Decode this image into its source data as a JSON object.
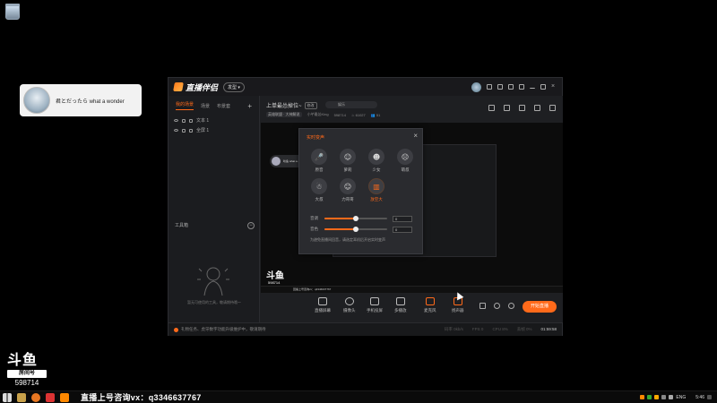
{
  "desktop": {
    "notification": {
      "text": "君とだったら what a wonder"
    },
    "watermark": {
      "brand": "斗鱼",
      "room_label": "房间号",
      "room_number": "598714"
    }
  },
  "taskbar": {
    "promo_text": "直播上号咨询vx：q3346637767",
    "tray": {
      "lang": "ENG",
      "time": "5:46"
    }
  },
  "app": {
    "name": "直播伴侣",
    "version_pill": "发型 ▾",
    "left_panel": {
      "tabs": [
        "我的场景",
        "场景",
        "布景套"
      ],
      "add_label": "+",
      "scenes": [
        "文本 1",
        "全屏 1"
      ],
      "toolbox_label": "工具箱",
      "empty_text": "暂无可使用的工具，敬请期待哦～"
    },
    "header": {
      "title": "上单最怂掉位~",
      "tag": "修改",
      "game_label": "娱乐",
      "sub_items": [
        "英雄联盟 · 大神解说",
        "小芊最怂King",
        "598714",
        "♨ 61027",
        "👥 51"
      ]
    },
    "preview": {
      "user_chip": "听鱼 what a...",
      "logo_text": "斗鱼",
      "room_number": "598714",
      "bar_text": "回播上号咨询vx：q3346637767"
    },
    "voice_dialog": {
      "title": "实时变声",
      "close": "×",
      "effects": [
        {
          "label": "原音",
          "icon": "🎤"
        },
        {
          "label": "萝莉",
          "icon": "☺"
        },
        {
          "label": "少女",
          "icon": "☻"
        },
        {
          "label": "萌叔",
          "icon": "☹"
        },
        {
          "label": "大叔",
          "icon": "☃"
        },
        {
          "label": "力哥哥",
          "icon": "☺"
        },
        {
          "label": "放空大",
          "icon": "▥"
        }
      ],
      "selected_effect": "放空大",
      "pitch": {
        "label": "音调",
        "value": "0",
        "level": 0.5
      },
      "voice": {
        "label": "音色",
        "value": "0",
        "level": 0.5
      },
      "note": "为避免直播间回音，请选定耳机后开启实时变声"
    },
    "toolbar": {
      "items": [
        "直播屏幕",
        "摄像头",
        "手机投屏",
        "多播放",
        "麦克风",
        "扬声器"
      ],
      "go_live": "开始直播"
    },
    "status": {
      "message": "礼物任务、虎牙数字功能升级维护中，敬请期待",
      "stats": [
        "码率 0kb/s",
        "FPS 0",
        "CPU 8%",
        "丢帧 0%"
      ],
      "time": "01:59:58"
    }
  }
}
